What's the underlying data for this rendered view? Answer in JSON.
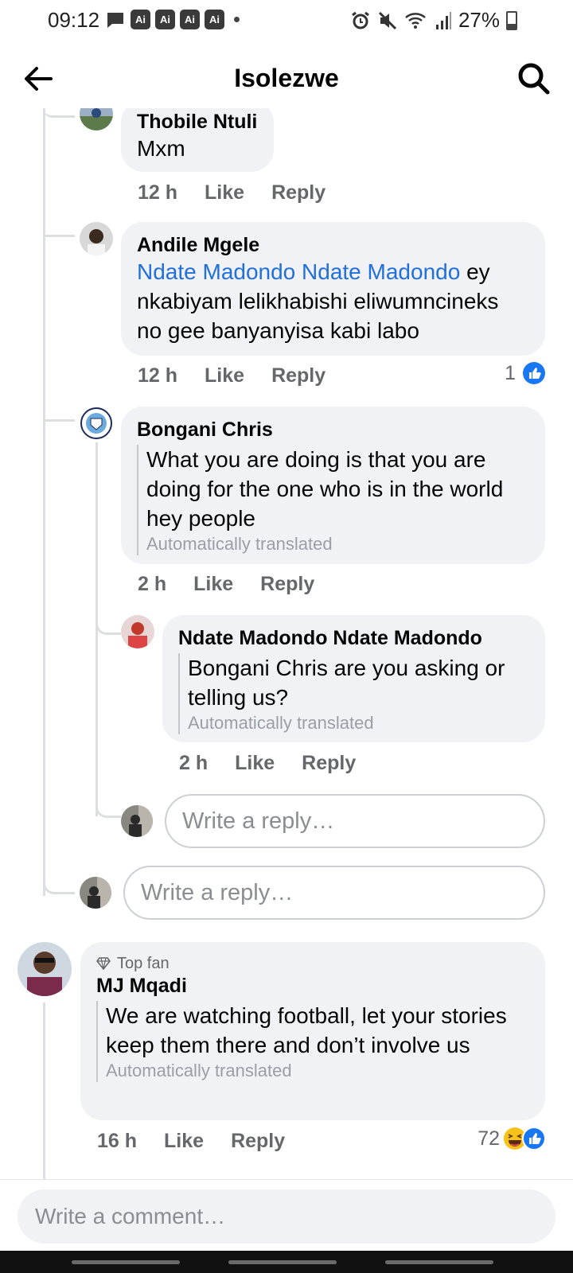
{
  "status_bar": {
    "time": "09:12",
    "ai_badges": [
      "Ai",
      "Ai",
      "Ai",
      "Ai"
    ],
    "battery": "27%"
  },
  "header": {
    "title": "Isolezwe"
  },
  "comments": {
    "thobile": {
      "author": "Thobile Ntuli",
      "text": "Mxm",
      "time": "12 h",
      "like": "Like",
      "reply": "Reply"
    },
    "andile": {
      "author": "Andile Mgele",
      "mention": "Ndate Madondo Ndate Madondo",
      "text": " ey nkabiyam lelikhabishi eliwumncineks no gee banyanyisa kabi labo",
      "time": "12 h",
      "like": "Like",
      "reply": "Reply",
      "reaction_count": "1"
    },
    "bongani": {
      "author": "Bongani Chris",
      "text": "What you are doing is that you are doing for the one who is in the world hey people",
      "translated_label": "Automatically translated",
      "time": "2 h",
      "like": "Like",
      "reply": "Reply"
    },
    "ndate": {
      "author": "Ndate Madondo Ndate Madondo",
      "text": "Bongani Chris are you asking or telling us?",
      "translated_label": "Automatically translated",
      "time": "2 h",
      "like": "Like",
      "reply": "Reply"
    },
    "mj": {
      "badge": "Top fan",
      "author": "MJ Mqadi",
      "text": "We are watching football, let your stories keep them there and don’t involve us",
      "translated_label": "Automatically translated",
      "time": "16 h",
      "like": "Like",
      "reply": "Reply",
      "reaction_count": "72"
    }
  },
  "reply_placeholders": {
    "nested": "Write a reply…",
    "thread": "Write a reply…"
  },
  "composer": {
    "placeholder": "Write a comment…"
  },
  "colors": {
    "mention": "#216fdb",
    "like_blue": "#1877f2",
    "bubble": "#f0f2f5"
  }
}
